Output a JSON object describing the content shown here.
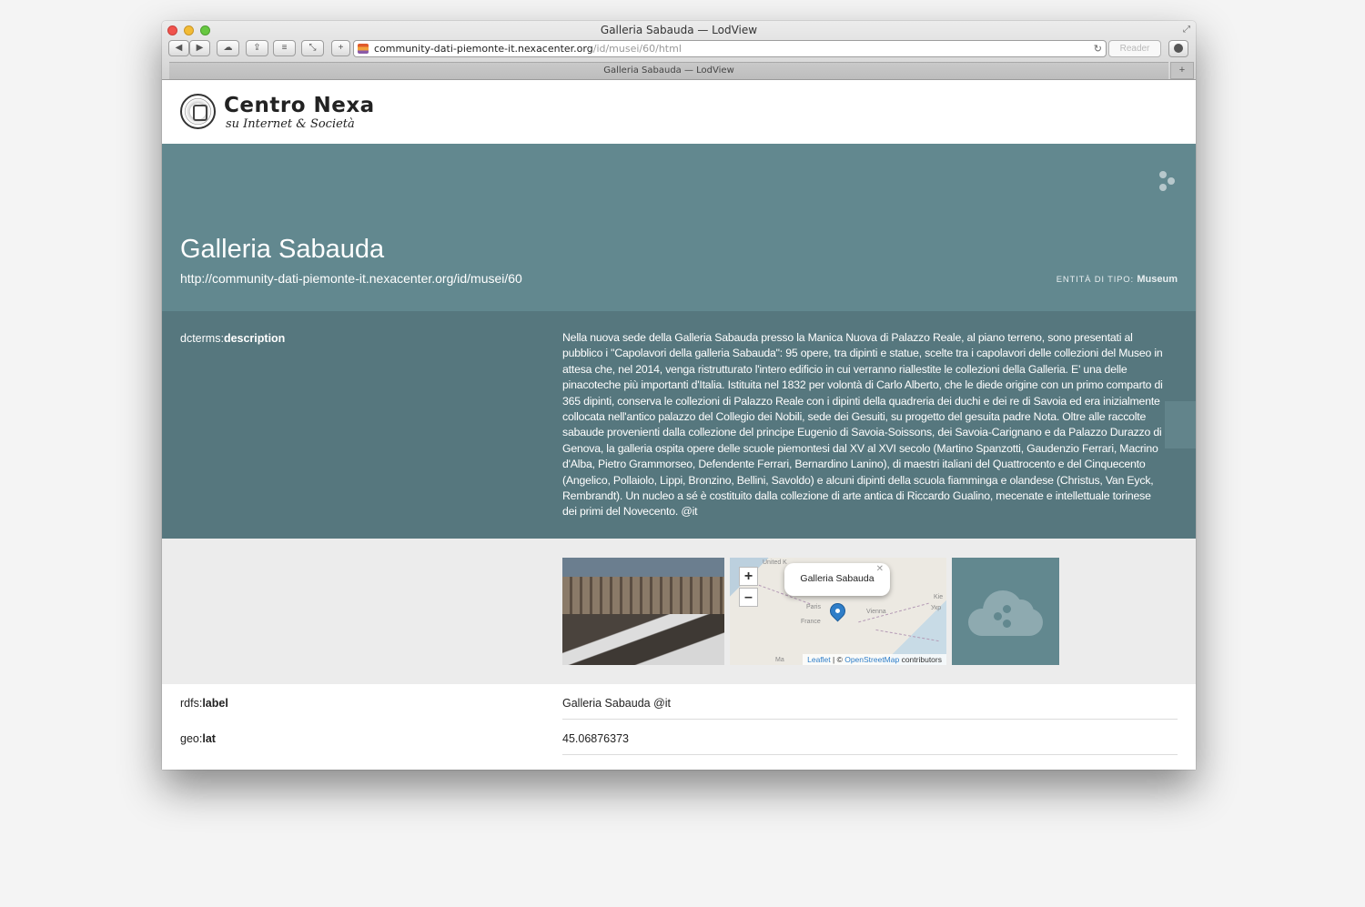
{
  "browser": {
    "window_title": "Galleria Sabauda — LodView",
    "url_host": "community-dati-piemonte-it.nexacenter.org",
    "url_path": "/id/musei/60/html",
    "reader_label": "Reader",
    "tab_title": "Galleria Sabauda — LodView",
    "back": "◀",
    "forward": "▶",
    "new_tab": "+"
  },
  "header": {
    "logo_name": "Centro Nexa",
    "logo_sub": "su Internet & Società"
  },
  "hero": {
    "title": "Galleria Sabauda",
    "uri": "http://community-dati-piemonte-it.nexacenter.org/id/musei/60",
    "type_prefix": "ENTITÀ DI TIPO: ",
    "type_value": "Museum",
    "accent_color": "#62888f"
  },
  "description": {
    "prefix": "dcterms:",
    "property": "description",
    "text": "Nella nuova sede della Galleria Sabauda presso la Manica Nuova di Palazzo Reale, al piano terreno, sono presentati al pubblico i \"Capolavori della galleria Sabauda\": 95 opere, tra dipinti e statue, scelte tra i capolavori delle collezioni del Museo in attesa che, nel 2014, venga ristrutturato l'intero edificio in cui verranno riallestite le collezioni della Galleria.   E' una delle pinacoteche più importanti d'Italia. Istituita nel 1832 per volontà di Carlo Alberto, che le diede origine con un primo comparto di 365 dipinti, conserva le collezioni di Palazzo Reale con i dipinti della quadreria dei duchi e dei re di Savoia ed era inizialmente collocata nell'antico palazzo del Collegio dei Nobili, sede dei Gesuiti, su progetto del gesuita padre Nota. Oltre alle raccolte sabaude provenienti dalla collezione del principe Eugenio di Savoia-Soissons, dei Savoia-Carignano e da Palazzo Durazzo di Genova, la galleria ospita opere delle scuole piemontesi dal XV al XVI secolo (Martino Spanzotti, Gaudenzio Ferrari, Macrino d'Alba, Pietro Grammorseo, Defendente Ferrari, Bernardino Lanino), di maestri italiani del Quattrocento e del Cinquecento (Angelico, Pollaiolo, Lippi, Bronzino, Bellini, Savoldo) e alcuni dipinti della scuola fiamminga e olandese (Christus, Van Eyck, Rembrandt). Un nucleo a sé è costituito dalla collezione di arte antica di Riccardo Gualino, mecenate e intellettuale torinese dei primi del Novecento. @it"
  },
  "map": {
    "zoom_in": "+",
    "zoom_out": "–",
    "popup": "Galleria Sabauda",
    "popup_close": "✕",
    "labels": [
      "United K",
      "Paris",
      "France",
      "Vienna",
      "Kie",
      "Укр",
      "Ma"
    ],
    "attribution_leaflet": "Leaflet",
    "attribution_mid": " | © ",
    "attribution_osm": "OpenStreetMap",
    "attribution_end": " contributors"
  },
  "properties": [
    {
      "prefix": "rdfs:",
      "name": "label",
      "value": "Galleria Sabauda @it"
    },
    {
      "prefix": "geo:",
      "name": "lat",
      "value": "45.06876373"
    }
  ]
}
